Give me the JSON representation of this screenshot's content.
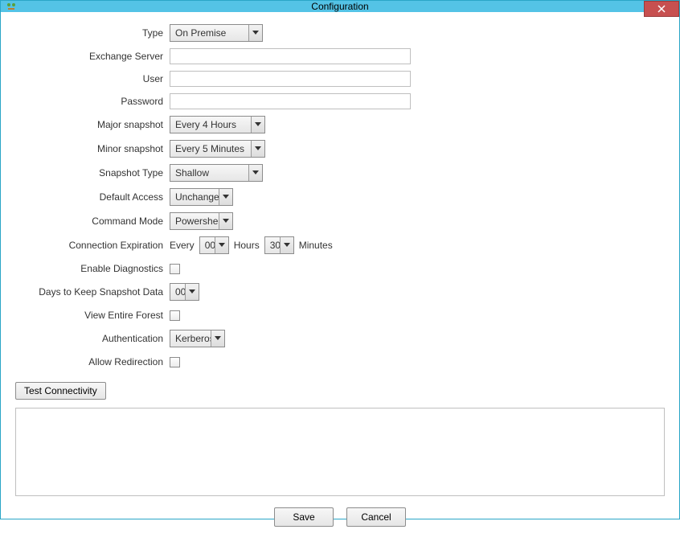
{
  "window": {
    "title": "Configuration",
    "close_icon": "close-icon"
  },
  "labels": {
    "type": "Type",
    "exchange_server": "Exchange Server",
    "user": "User",
    "password": "Password",
    "major_snapshot": "Major snapshot",
    "minor_snapshot": "Minor snapshot",
    "snapshot_type": "Snapshot Type",
    "default_access": "Default Access",
    "command_mode": "Command Mode",
    "connection_expiration": "Connection Expiration",
    "enable_diagnostics": "Enable Diagnostics",
    "days_to_keep": "Days to Keep Snapshot Data",
    "view_entire_forest": "View Entire Forest",
    "authentication": "Authentication",
    "allow_redirection": "Allow Redirection"
  },
  "values": {
    "type": "On Premise",
    "exchange_server": "",
    "user": "",
    "password": "",
    "major_snapshot": "Every 4 Hours",
    "minor_snapshot": "Every 5 Minutes",
    "snapshot_type": "Shallow",
    "default_access": "Unchanged",
    "command_mode": "Powershell",
    "conn_every_label": "Every",
    "conn_hours": "00",
    "conn_hours_label": "Hours",
    "conn_minutes": "30",
    "conn_minutes_label": "Minutes",
    "enable_diagnostics": false,
    "days_to_keep": "00",
    "view_entire_forest": false,
    "authentication": "Kerberos",
    "allow_redirection": false
  },
  "buttons": {
    "test_connectivity": "Test Connectivity",
    "save": "Save",
    "cancel": "Cancel"
  }
}
